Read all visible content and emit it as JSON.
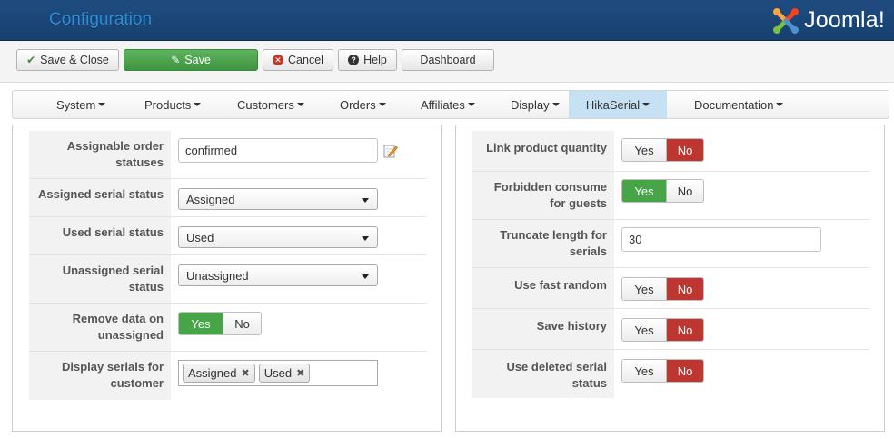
{
  "header": {
    "title": "Configuration",
    "brand": "Joomla!"
  },
  "toolbar": {
    "save_close": "Save & Close",
    "save": "Save",
    "cancel": "Cancel",
    "help": "Help",
    "dashboard": "Dashboard"
  },
  "menu": {
    "items": [
      {
        "label": "System"
      },
      {
        "label": "Products"
      },
      {
        "label": "Customers"
      },
      {
        "label": "Orders"
      },
      {
        "label": "Affiliates"
      },
      {
        "label": "Display"
      },
      {
        "label": "HikaSerial",
        "active": true
      },
      {
        "label": "Documentation"
      }
    ]
  },
  "left": {
    "assignable": {
      "label": "Assignable order statuses",
      "value": "confirmed"
    },
    "assigned": {
      "label": "Assigned serial status",
      "value": "Assigned"
    },
    "used": {
      "label": "Used serial status",
      "value": "Used"
    },
    "unassigned": {
      "label": "Unassigned serial status",
      "value": "Unassigned"
    },
    "remove": {
      "label": "Remove data on unassigned",
      "yes": "Yes",
      "no": "No",
      "selected": "Yes"
    },
    "display": {
      "label": "Display serials for customer",
      "tags": [
        "Assigned",
        "Used"
      ]
    }
  },
  "right": {
    "link_qty": {
      "label": "Link product quantity",
      "yes": "Yes",
      "no": "No",
      "selected": "No"
    },
    "forbidden": {
      "label": "Forbidden consume for guests",
      "yes": "Yes",
      "no": "No",
      "selected": "Yes"
    },
    "truncate": {
      "label": "Truncate length for serials",
      "value": "30"
    },
    "fast_random": {
      "label": "Use fast random",
      "yes": "Yes",
      "no": "No",
      "selected": "No"
    },
    "save_history": {
      "label": "Save history",
      "yes": "Yes",
      "no": "No",
      "selected": "No"
    },
    "deleted_status": {
      "label": "Use deleted serial status",
      "yes": "Yes",
      "no": "No",
      "selected": "No"
    }
  },
  "colors": {
    "header_bg": "#1f4c80",
    "title": "#2a8fd8",
    "yes_active": "#46a546",
    "no_active": "#bd362f",
    "menu_active": "#c5e1f3"
  }
}
